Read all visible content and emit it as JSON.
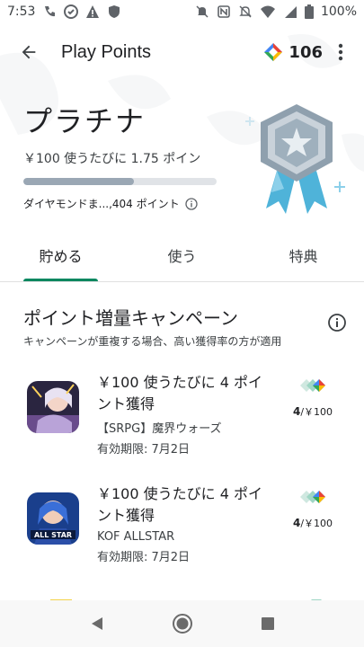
{
  "status": {
    "time": "7:53",
    "battery": "100%"
  },
  "appbar": {
    "title": "Play Points",
    "points": "106"
  },
  "tier": {
    "name": "プラチナ",
    "rate_text": "￥100 使うたびに 1.75 ポイン",
    "progress_fraction": 0.57,
    "next_text": "ダイヤモンドま...,404 ポイント"
  },
  "tabs": [
    {
      "label": "貯める",
      "active": true
    },
    {
      "label": "使う",
      "active": false
    },
    {
      "label": "特典",
      "active": false
    }
  ],
  "campaign": {
    "heading": "ポイント増量キャンペーン",
    "subtext": "キャンペーンが重複する場合、高い獲得率の方が適用"
  },
  "offers": [
    {
      "title": "￥100 使うたびに 4 ポイント獲得",
      "game": "【SRPG】魔界ウォーズ",
      "expiry": "有効期限: 7月2日",
      "rate_num": "4",
      "rate_unit": "/￥100"
    },
    {
      "title": "￥100 使うたびに 4 ポイント獲得",
      "game": "KOF ALLSTAR",
      "expiry": "有効期限: 7月2日",
      "rate_num": "4",
      "rate_unit": "/￥100"
    }
  ],
  "colors": {
    "accent": "#01875f",
    "progress_fill": "#9aa7b4",
    "medal_silver": "#8fa0ae",
    "medal_ribbon": "#4fb3d9"
  }
}
